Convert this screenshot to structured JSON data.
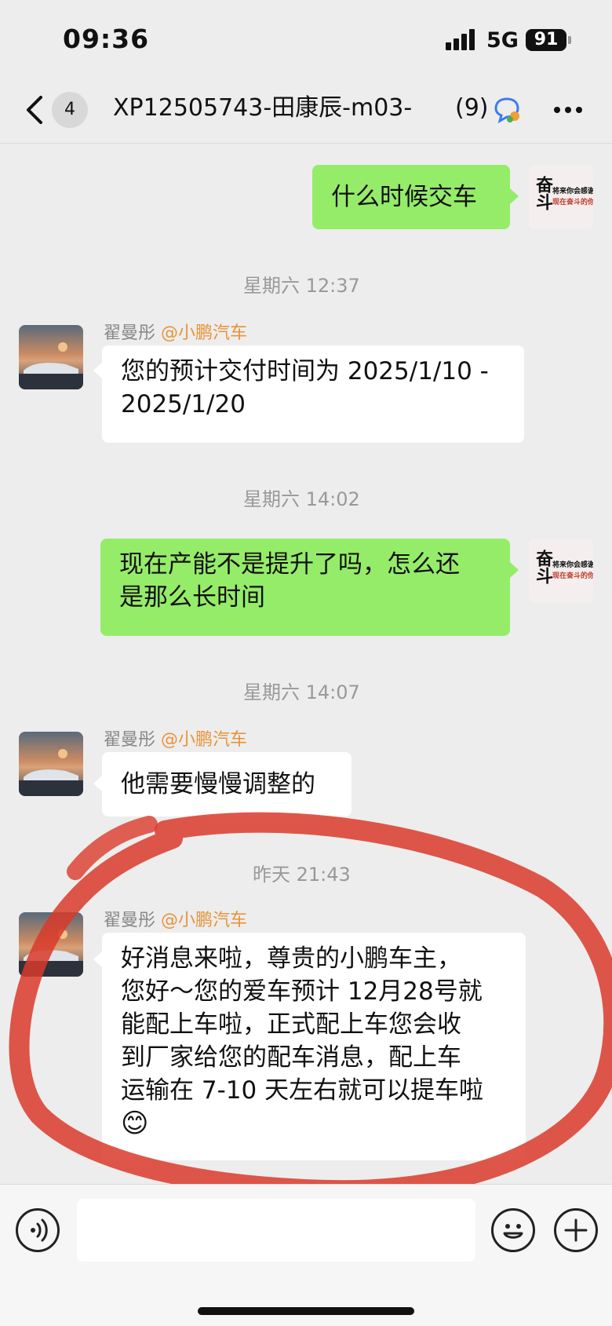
{
  "status_bar": {
    "time": "09:36",
    "network": "5G",
    "battery": "91"
  },
  "nav": {
    "back_badge": "4",
    "title": "XP12505743-田康辰-m03-",
    "member_count": "(9)"
  },
  "messages": [
    {
      "type": "out",
      "text": "什么时候交车"
    },
    {
      "type": "time",
      "text": "星期六 12:37"
    },
    {
      "type": "in",
      "sender": "翟曼彤",
      "sender_org": "@小鹏汽车",
      "lines": [
        "您的预计交付时间为 2025/1/10 -",
        "2025/1/20"
      ]
    },
    {
      "type": "time",
      "text": "星期六 14:02"
    },
    {
      "type": "out",
      "lines": [
        "现在产能不是提升了吗，怎么还",
        "是那么长时间"
      ]
    },
    {
      "type": "time",
      "text": "星期六 14:07"
    },
    {
      "type": "in",
      "sender": "翟曼彤",
      "sender_org": "@小鹏汽车",
      "text": "他需要慢慢调整的"
    },
    {
      "type": "time",
      "text": "昨天 21:43"
    },
    {
      "type": "in",
      "sender": "翟曼彤",
      "sender_org": "@小鹏汽车",
      "lines": [
        "好消息来啦，尊贵的小鹏车主，",
        "您好～您的爱车预计 12月28号就",
        "能配上车啦，正式配上车您会收",
        "到厂家给您的配车消息，配上车",
        "运输在 7-10 天左右就可以提车啦"
      ],
      "emoji": "😊"
    }
  ],
  "my_avatar_text": {
    "main": "奋斗",
    "line1": "将来你会感谢",
    "line2": "现在奋斗的你!"
  },
  "annotation": {
    "color": "#d93a2a"
  }
}
